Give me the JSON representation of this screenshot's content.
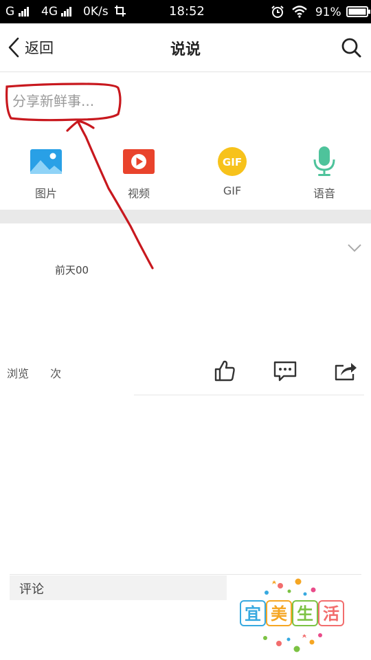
{
  "status_bar": {
    "carrier": "G",
    "network": "4G",
    "speed": "0K/s",
    "time": "18:52",
    "battery": "91%"
  },
  "nav": {
    "back_label": "返回",
    "title": "说说"
  },
  "composer": {
    "placeholder": "分享新鲜事..."
  },
  "media_options": [
    {
      "label": "图片",
      "icon": "image-icon",
      "color": "#29a0e6"
    },
    {
      "label": "视频",
      "icon": "video-icon",
      "color": "#e9432c"
    },
    {
      "label": "GIF",
      "icon": "gif-icon",
      "color": "#f7c21b"
    },
    {
      "label": "语音",
      "icon": "microphone-icon",
      "color": "#4ec39b"
    }
  ],
  "post": {
    "time": "前天00",
    "views_text": "浏览 次"
  },
  "comments": {
    "label": "评论"
  },
  "watermark": {
    "text": [
      "宜",
      "美",
      "生",
      "活"
    ],
    "colors": [
      "#37a9e0",
      "#f5a623",
      "#7cc243",
      "#f26d6d"
    ]
  },
  "annotation_color": "#c8181e"
}
